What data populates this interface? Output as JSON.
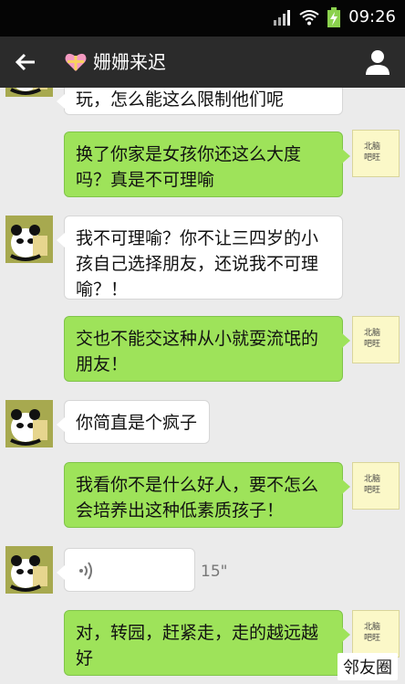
{
  "status_bar": {
    "time": "09:26",
    "icons": [
      "signal-icon",
      "wifi-icon",
      "battery-charging-icon"
    ]
  },
  "header": {
    "title": "姗姗来迟",
    "title_icon": "gift-heart-icon",
    "back_icon": "back-arrow-icon",
    "profile_icon": "profile-icon"
  },
  "messages": [
    {
      "side": "left",
      "text": "玩，怎么能这么限制他们呢"
    },
    {
      "side": "right",
      "text": "换了你家是女孩你还这么大度吗？真是不可理喻"
    },
    {
      "side": "left",
      "text": "我不可理喻？你不让三四岁的小孩自己选择朋友，还说我不可理喻？！"
    },
    {
      "side": "right",
      "text": "交也不能交这种从小就耍流氓的朋友！"
    },
    {
      "side": "left",
      "text": "你简直是个疯子"
    },
    {
      "side": "right",
      "text": "我看你不是什么好人，要不怎么会培养出这种低素质孩子！"
    },
    {
      "side": "left",
      "type": "voice",
      "duration": "15\""
    },
    {
      "side": "right",
      "text": "对，转园，赶紧走，走的越远越好"
    }
  ],
  "avatar_note_text": [
    "北脑",
    "吧旺"
  ],
  "watermark": "邻友圈",
  "colors": {
    "statusbar_bg": "#050505",
    "titlebar_bg": "#2b2b2b",
    "chat_bg": "#ebebeb",
    "bubble_me": "#9ee35a",
    "bubble_other": "#ffffff"
  }
}
